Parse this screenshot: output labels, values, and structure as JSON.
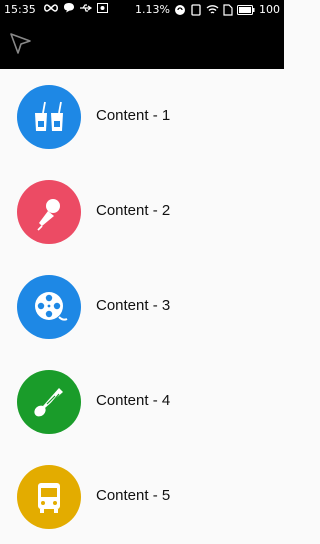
{
  "status_bar": {
    "time": "15:35",
    "speed": "1.13",
    "speed_unit": "%",
    "battery": "100",
    "icons": [
      "infinity-icon",
      "chat-icon",
      "usb-icon",
      "photo-icon",
      "data-icon",
      "sync-icon",
      "wifi-icon",
      "sim-icon",
      "battery-icon"
    ]
  },
  "toolbar": {
    "nav_icon": "navigation-arrow-icon"
  },
  "items": [
    {
      "label": "Content - 1",
      "icon": "drinks-icon",
      "color": "#1e88e5"
    },
    {
      "label": "Content - 2",
      "icon": "microphone-icon",
      "color": "#ec4b64"
    },
    {
      "label": "Content - 3",
      "icon": "film-reel-icon",
      "color": "#1e88e5"
    },
    {
      "label": "Content - 4",
      "icon": "shuttlecock-icon",
      "color": "#1a9c2a"
    },
    {
      "label": "Content - 5",
      "icon": "bus-icon",
      "color": "#e3ac00"
    }
  ]
}
